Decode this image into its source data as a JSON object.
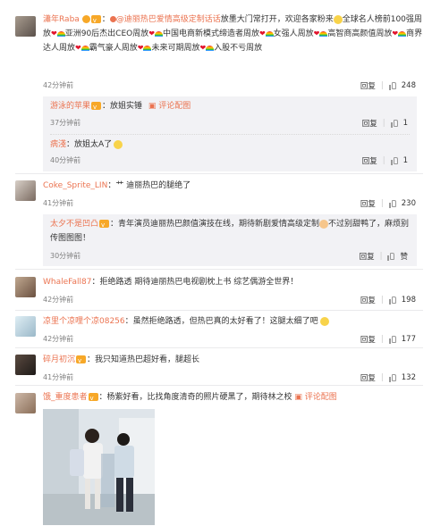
{
  "comments": [
    {
      "user": "瀟年Raba",
      "colon": "：",
      "ref": "@迪丽热巴爱情高级定制话话",
      "text": "放墨大门常打开，欢迎各家粉来",
      "text2": "全球名人榜前100强周放",
      "parts": [
        "亚洲90后杰出CEO周放",
        "中国电商新模式缔造者周放",
        "女强人周放",
        "高智商高颜值周放",
        "商界达人周放",
        "霸气豪人周放",
        "未来可期周放",
        "入股不亏周放"
      ],
      "time": "42分钟前",
      "reply": "回复",
      "likes": "248",
      "subs": [
        {
          "user": "游泳的苹果",
          "text": "：放姐实锤",
          "time": "37分钟前",
          "reply": "回复",
          "likes": "1",
          "extra": "评论配图"
        },
        {
          "user": "病淺",
          "text": "：放姐太A了",
          "time": "40分钟前",
          "reply": "回复",
          "likes": "1"
        }
      ]
    },
    {
      "user": "Coke_Sprite_LIN",
      "text": "：艹 迪丽热巴的腿绝了",
      "time": "41分钟前",
      "reply": "回复",
      "likes": "230",
      "subs": [
        {
          "user": "太夕不是凹凸",
          "text": "：青年演员迪丽热巴颜值演技在线，期待新剧爱情高级定制",
          "text2": "不过别甜鸭了，麻烦别传图图图！",
          "time": "30分钟前",
          "reply": "回复",
          "likes": "赞"
        }
      ]
    },
    {
      "user": "WhaleFall87",
      "text": "：拒绝路透 期待迪丽热巴电视剧枕上书 综艺偶游全世界！",
      "time": "42分钟前",
      "reply": "回复",
      "likes": "198"
    },
    {
      "user": "凉里个凉哩个凉08256",
      "text": "：虽然拒绝路透，但热巴真的太好看了！这腿太细了吧",
      "time": "42分钟前",
      "reply": "回复",
      "likes": "177"
    },
    {
      "user": "碎月初沉",
      "text": "：我只知道热巴超好看，腿超长",
      "time": "41分钟前",
      "reply": "回复",
      "likes": "132"
    },
    {
      "user": "饿_重度患者",
      "text": "：杨紫好看，比找角度清奇的照片硬黑了，期待林之校",
      "extra": "评论配图",
      "time": "",
      "reply": ""
    }
  ]
}
